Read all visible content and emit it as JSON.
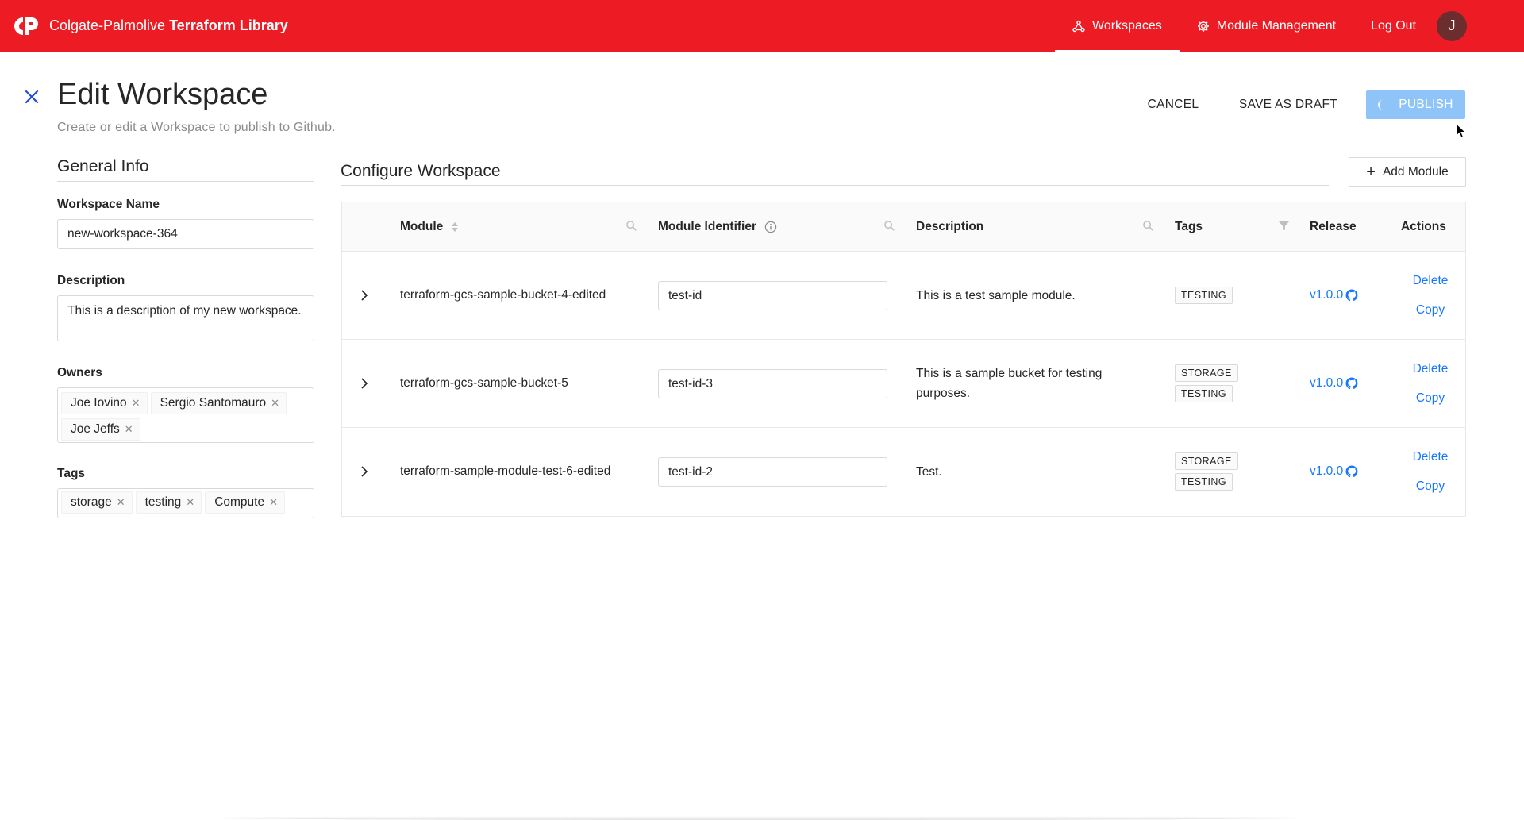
{
  "header": {
    "brand_prefix": "Colgate-Palmolive",
    "brand_bold": "Terraform Library",
    "nav": [
      {
        "label": "Workspaces",
        "icon": "workspaces-icon"
      },
      {
        "label": "Module Management",
        "icon": "gear-icon"
      },
      {
        "label": "Log Out"
      }
    ],
    "avatar_initial": "J",
    "colors": {
      "brand": "#ed1c24",
      "accent": "#1677ff",
      "publish": "#8fc4f8"
    }
  },
  "page": {
    "title": "Edit Workspace",
    "subtitle": "Create or edit a Workspace to publish to Github.",
    "buttons": {
      "cancel": "CANCEL",
      "draft": "SAVE AS DRAFT",
      "publish": "PUBLISH"
    }
  },
  "general": {
    "title": "General Info",
    "name_label": "Workspace Name",
    "name_value": "new-workspace-364",
    "desc_label": "Description",
    "desc_value": "This is a description of my new workspace.",
    "owners_label": "Owners",
    "owners": [
      "Joe Iovino",
      "Sergio Santomauro",
      "Joe Jeffs"
    ],
    "tags_label": "Tags",
    "tags": [
      "storage",
      "testing",
      "Compute"
    ]
  },
  "configure": {
    "title": "Configure Workspace",
    "add_module": "Add Module",
    "columns": {
      "module": "Module",
      "identifier": "Module Identifier",
      "description": "Description",
      "tags": "Tags",
      "release": "Release",
      "actions": "Actions"
    },
    "rows": [
      {
        "module": "terraform-gcs-sample-bucket-4-edited",
        "identifier": "test-id",
        "description": "This is a test sample module.",
        "tags": [
          "TESTING"
        ],
        "release": "v1.0.0",
        "delete": "Delete",
        "copy": "Copy"
      },
      {
        "module": "terraform-gcs-sample-bucket-5",
        "identifier": "test-id-3",
        "description": "This is a sample bucket for testing purposes.",
        "tags": [
          "STORAGE",
          "TESTING"
        ],
        "release": "v1.0.0",
        "delete": "Delete",
        "copy": "Copy"
      },
      {
        "module": "terraform-sample-module-test-6-edited",
        "identifier": "test-id-2",
        "description": "Test.",
        "tags": [
          "STORAGE",
          "TESTING"
        ],
        "release": "v1.0.0",
        "delete": "Delete",
        "copy": "Copy"
      }
    ]
  }
}
